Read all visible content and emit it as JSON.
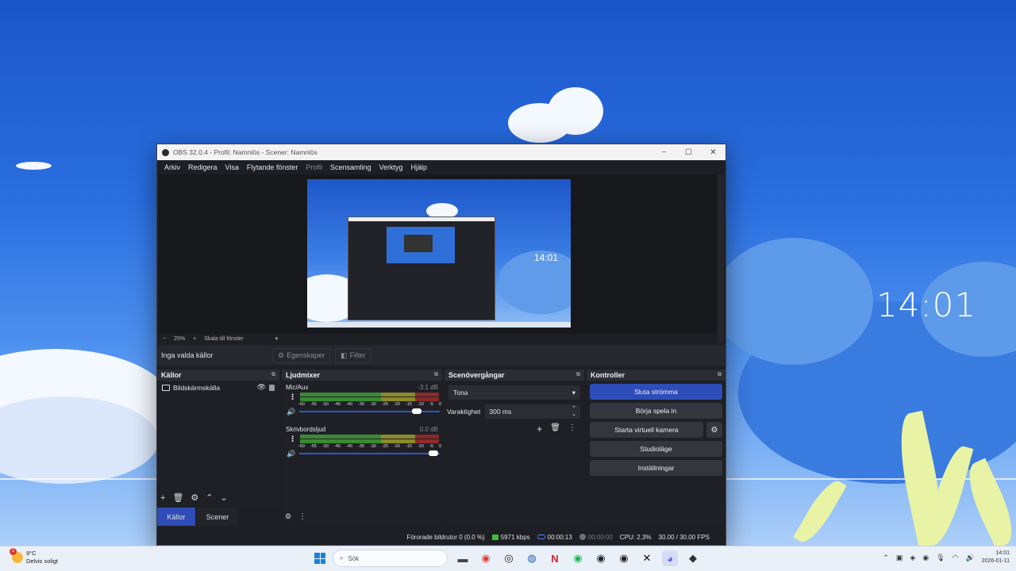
{
  "desktop": {
    "clock": "14:01"
  },
  "window": {
    "title": "OBS 32.0.4 - Profil: Namnlös - Scener: Namnlös",
    "controls": {
      "minimize": "−",
      "maximize": "☐",
      "close": "✕"
    }
  },
  "menu": [
    "Arkiv",
    "Redigera",
    "Visa",
    "Flytande fönster",
    "Profil",
    "Scensamling",
    "Verktyg",
    "Hjälp"
  ],
  "preview": {
    "zoom_minus": "−",
    "zoom_level": "25%",
    "zoom_plus": "+",
    "scale_mode": "Skala till fönster",
    "inner_clock": "14:01"
  },
  "context": {
    "no_source": "Inga valda källor",
    "properties": "Egenskaper",
    "filters": "Filter"
  },
  "sources": {
    "title": "Källor",
    "items": [
      {
        "name": "Bildskärmskälla"
      }
    ]
  },
  "tabs": {
    "sources": "Källor",
    "scenes": "Scener"
  },
  "mixer": {
    "title": "Ljudmixer",
    "ticks": [
      "-60",
      "-55",
      "-50",
      "-45",
      "-40",
      "-35",
      "-30",
      "-25",
      "-20",
      "-15",
      "-10",
      "-5",
      "0"
    ],
    "channels": [
      {
        "name": "Mic/Aux",
        "db": "-3.1 dB",
        "volume": 0.86
      },
      {
        "name": "Skrivbordsljud",
        "db": "0.0 dB",
        "volume": 0.99
      }
    ]
  },
  "transitions": {
    "title": "Scenövergångar",
    "selected": "Tona",
    "duration_label": "Varaktighet",
    "duration_value": "300 ms"
  },
  "controls": {
    "title": "Kontroller",
    "stop_streaming": "Sluta strömma",
    "start_recording": "Börja spela in",
    "start_virtual_camera": "Starta virtuell kamera",
    "studio_mode": "Studioläge",
    "settings": "Inställningar"
  },
  "status": {
    "dropped_frames": "Förorade bildrutor 0 (0.0 %)",
    "bitrate": "5971 kbps",
    "stream_time": "00:00:13",
    "record_time": "00:00:00",
    "cpu": "CPU: 2.3%",
    "fps": "30.00 / 30.00 FPS"
  },
  "taskbar": {
    "weather_temp": "9°C",
    "weather_desc": "Delvis soligt",
    "weather_badge": "2",
    "search_placeholder": "Sök",
    "time": "14:01",
    "date": "2026-01-11"
  },
  "colors": {
    "accent": "#2f4db8",
    "meter_green": "#3a8a34",
    "meter_yellow": "#8c8a2a",
    "meter_red": "#8a2a2a"
  }
}
